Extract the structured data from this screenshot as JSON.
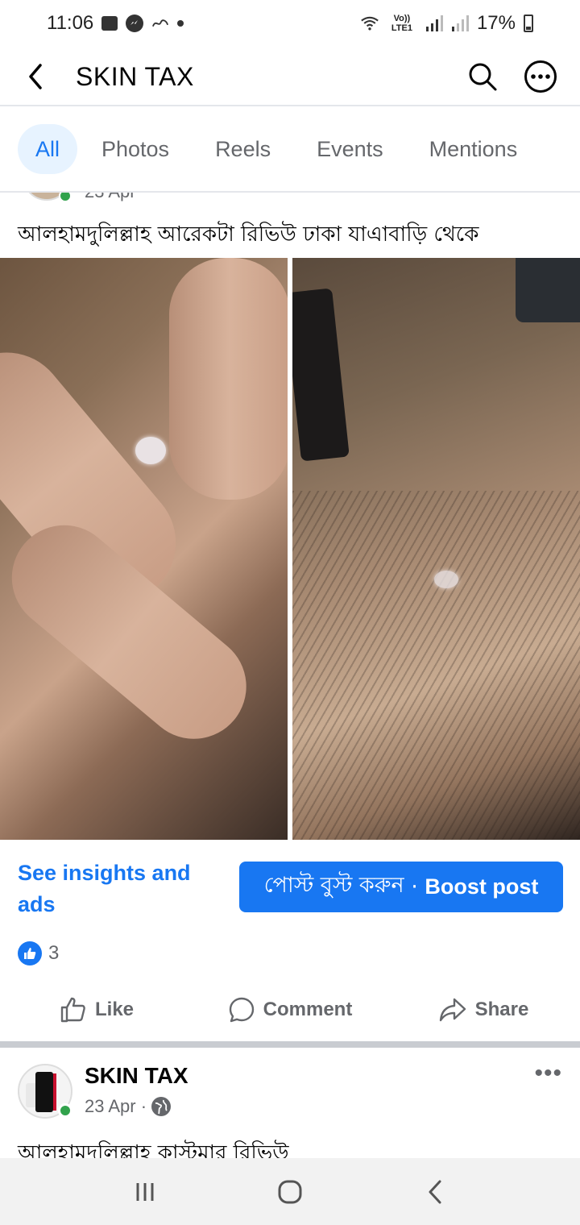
{
  "status_bar": {
    "time": "11:06",
    "network_label": "Vo)) LTE1",
    "battery": "17%"
  },
  "header": {
    "title": "SKIN TAX"
  },
  "tabs": [
    {
      "label": "All",
      "active": true
    },
    {
      "label": "Photos",
      "active": false
    },
    {
      "label": "Reels",
      "active": false
    },
    {
      "label": "Events",
      "active": false
    },
    {
      "label": "Mentions",
      "active": false
    }
  ],
  "post1": {
    "date_partial": "23 Apr",
    "text": "আলহামদুলিল্লাহ আরেকটা রিভিউ ঢাকা যাএাবাড়ি থেকে",
    "insights_link": "See insights and ads",
    "boost_label_bn": "পোস্ট বুস্ট করুন",
    "boost_separator": " · ",
    "boost_label_en": "Boost post",
    "reaction_count": "3",
    "actions": {
      "like": "Like",
      "comment": "Comment",
      "share": "Share"
    }
  },
  "post2": {
    "author": "SKIN TAX",
    "date": "23 Apr ·",
    "more": "•••",
    "text": "আলহামদুলিল্লাহ কাস্টমার রিভিউ",
    "avatar_brand": "SKIN TAX"
  },
  "colors": {
    "brand_blue": "#1877f2",
    "tab_active_bg": "#e7f3ff",
    "muted_text": "#65676b",
    "online_green": "#31a24c"
  },
  "icons": {
    "back": "chevron-left-icon",
    "search": "search-icon",
    "more": "more-horizontal-icon",
    "like": "thumbs-up-icon",
    "comment": "comment-bubble-icon",
    "share": "share-arrow-icon",
    "globe": "globe-icon",
    "nav_recents": "recents-icon",
    "nav_home": "home-icon",
    "nav_back": "back-icon"
  }
}
